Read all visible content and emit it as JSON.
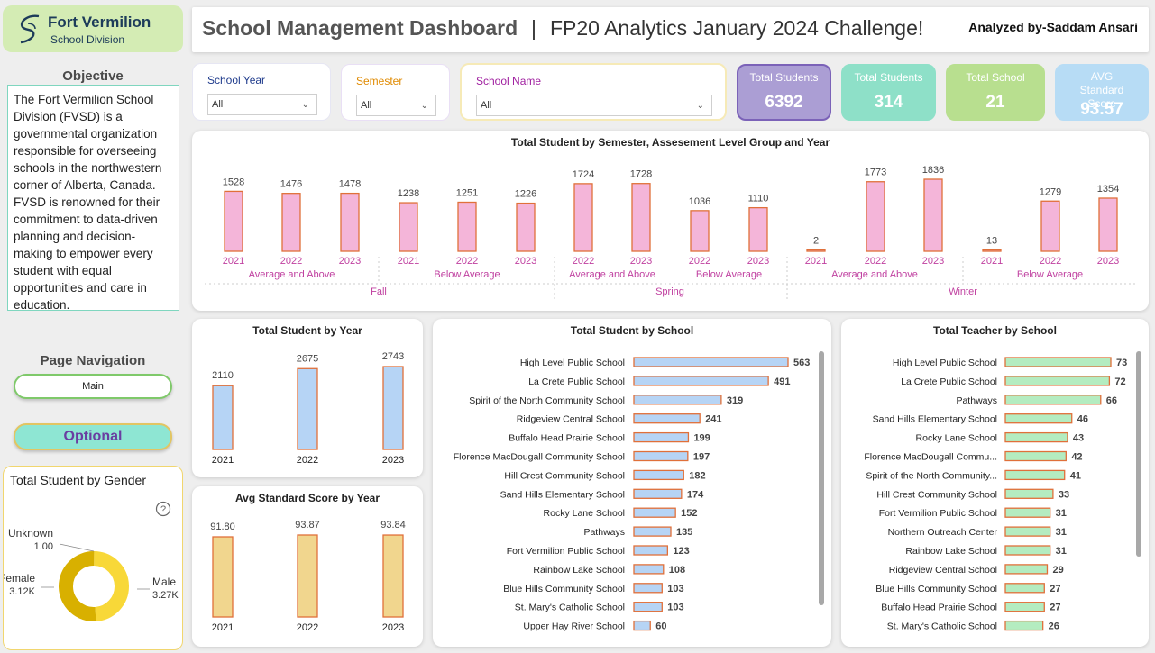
{
  "logo": {
    "title": "Fort Vermilion",
    "subtitle": "School Division"
  },
  "objective": {
    "heading": "Objective",
    "text": "The Fort Vermilion School Division (FVSD) is a governmental organization responsible for overseeing schools in the northwestern corner of Alberta, Canada. FVSD is renowned for their commitment to data-driven planning and decision-making to empower every student with equal opportunities and care in education."
  },
  "navigation": {
    "heading": "Page Navigation",
    "main_label": "Main",
    "optional_label": "Optional"
  },
  "header": {
    "title": "School Management Dashboard",
    "separator": "|",
    "subtitle": "FP20 Analytics January 2024 Challenge!",
    "analyzed_by": "Analyzed by-Saddam Ansari"
  },
  "filters": [
    {
      "label": "School Year",
      "value": "All",
      "color": "#1f3b8c"
    },
    {
      "label": "Semester",
      "value": "All",
      "color": "#e08a00"
    },
    {
      "label": "School Name",
      "value": "All",
      "color": "#a020a0"
    }
  ],
  "kpis": [
    {
      "title": "Total Students",
      "value": "6392",
      "bg": "#ab9ed4",
      "border": "#7b62b8"
    },
    {
      "title": "Total Students",
      "value": "314",
      "bg": "#8ee0c8",
      "border": "#8ee0c8"
    },
    {
      "title": "Total School",
      "value": "21",
      "bg": "#b8df8f",
      "border": "#b8df8f"
    },
    {
      "title": "AVG Standard Score",
      "value": "93.57",
      "bg": "#b7dcf5",
      "border": "#b7dcf5"
    }
  ],
  "colors": {
    "pink": "#f4b5d9",
    "orange_border": "#e0703a",
    "blue": "#b6d4f5",
    "green": "#b4ecc0",
    "yellow": "#f1d68e",
    "donut_dark": "#d8b000",
    "donut_light": "#f8d838",
    "axis_pink": "#c040a0"
  },
  "chart_data": [
    {
      "type": "bar",
      "title": "Total Student by Semester, Assesement Level Group and Year",
      "groups": [
        {
          "semester": "Fall",
          "level": "Average and Above",
          "years": [
            "2021",
            "2022",
            "2023"
          ],
          "values": [
            1528,
            1476,
            1478
          ]
        },
        {
          "semester": "Fall",
          "level": "Below Average",
          "years": [
            "2021",
            "2022",
            "2023"
          ],
          "values": [
            1238,
            1251,
            1226
          ]
        },
        {
          "semester": "Spring",
          "level": "Average and Above",
          "years": [
            "2022",
            "2023"
          ],
          "values": [
            1724,
            1728
          ]
        },
        {
          "semester": "Spring",
          "level": "Below Average",
          "years": [
            "2022",
            "2023"
          ],
          "values": [
            1036,
            1110
          ]
        },
        {
          "semester": "Winter",
          "level": "Average and Above",
          "years": [
            "2021",
            "2022",
            "2023"
          ],
          "values": [
            2,
            1773,
            1836
          ]
        },
        {
          "semester": "Winter",
          "level": "Below Average",
          "years": [
            "2021",
            "2022",
            "2023"
          ],
          "values": [
            13,
            1279,
            1354
          ]
        }
      ],
      "semesters": [
        "Fall",
        "Spring",
        "Winter"
      ]
    },
    {
      "type": "bar",
      "title": "Total Student by Year",
      "categories": [
        "2021",
        "2022",
        "2023"
      ],
      "values": [
        2110,
        2675,
        2743
      ]
    },
    {
      "type": "bar",
      "title": "Avg Standard Score by Year",
      "categories": [
        "2021",
        "2022",
        "2023"
      ],
      "values": [
        "91.80",
        "93.87",
        "93.84"
      ]
    },
    {
      "type": "bar",
      "orientation": "horizontal",
      "title": "Total Student by School",
      "categories": [
        "High Level Public School",
        "La Crete Public School",
        "Spirit of the North Community School",
        "Ridgeview Central School",
        "Buffalo Head Prairie School",
        "Florence MacDougall Community School",
        "Hill Crest Community School",
        "Sand Hills Elementary School",
        "Rocky Lane School",
        "Pathways",
        "Fort Vermilion Public School",
        "Rainbow Lake School",
        "Blue Hills Community School",
        "St. Mary's Catholic School",
        "Upper Hay River School"
      ],
      "values": [
        563,
        491,
        319,
        241,
        199,
        197,
        182,
        174,
        152,
        135,
        123,
        108,
        103,
        103,
        60
      ]
    },
    {
      "type": "bar",
      "orientation": "horizontal",
      "title": "Total Teacher by School",
      "categories": [
        "High Level Public School",
        "La Crete Public School",
        "Pathways",
        "Sand Hills Elementary School",
        "Rocky Lane School",
        "Florence MacDougall Commu...",
        "Spirit of the North Community...",
        "Hill Crest Community School",
        "Fort Vermilion Public School",
        "Northern Outreach Center",
        "Rainbow Lake School",
        "Ridgeview Central School",
        "Blue Hills Community School",
        "Buffalo Head Prairie School",
        "St. Mary's Catholic School"
      ],
      "values": [
        73,
        72,
        66,
        46,
        43,
        42,
        41,
        33,
        31,
        31,
        31,
        29,
        27,
        27,
        26
      ]
    },
    {
      "type": "pie",
      "title": "Total Student by Gender",
      "labels": [
        "Unknown",
        "Female",
        "Male"
      ],
      "value_labels": [
        "1.00",
        "3.12K",
        "3.27K"
      ],
      "values": [
        1,
        3120,
        3270
      ]
    }
  ]
}
